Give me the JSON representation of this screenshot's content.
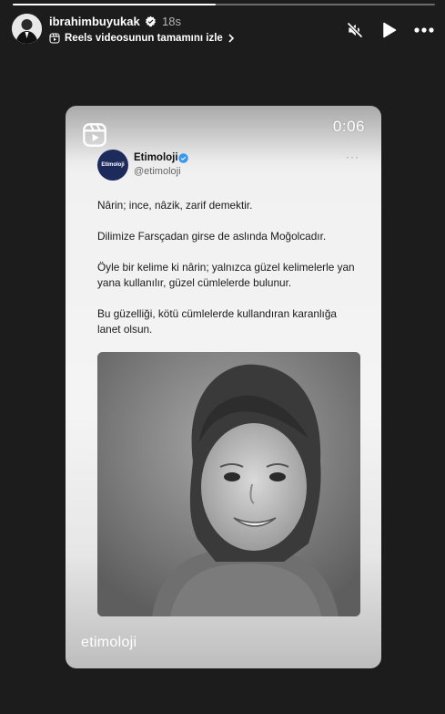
{
  "story": {
    "progress": 0.48,
    "username": "ibrahimbuyukak",
    "time_ago": "18s",
    "reel_link_label": "Reels videosunun tamamını izle",
    "actions": {
      "mute": "muted-speaker-icon",
      "play": "play-icon",
      "more": "more-icon"
    }
  },
  "card": {
    "timer": "0:06",
    "watermark": "etimoloji"
  },
  "tweet": {
    "logo_text": "Etimoloji",
    "name": "Etimoloji",
    "handle": "@etimoloji",
    "more": "···",
    "paragraphs": [
      "Nârin; ince, nâzik, zarif demektir.",
      "Dilimize Farsçadan girse de aslında Moğolcadır.",
      "Öyle bir kelime ki nârin; yalnızca güzel kelimelerle yan yana kullanılır, güzel cümlelerde bulunur.",
      "Bu güzelliği, kötü cümlelerde kullandıran karanlığa lanet olsun."
    ]
  },
  "colors": {
    "verified_blue": "#3897f0",
    "background": "#1c1c1c"
  }
}
